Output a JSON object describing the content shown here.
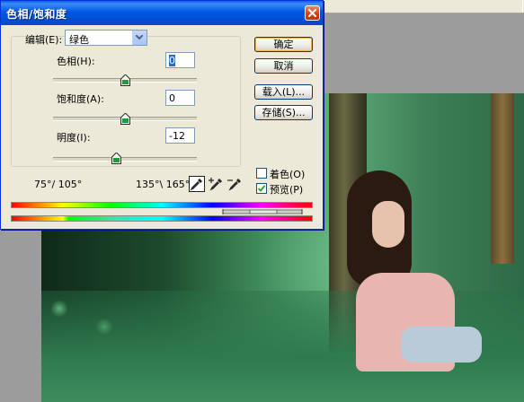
{
  "dialog": {
    "title": "色相/饱和度",
    "edit_label": "编辑(E):",
    "edit_value": "绿色",
    "hue_label": "色相(H):",
    "hue_value": "0",
    "saturation_label": "饱和度(A):",
    "saturation_value": "0",
    "lightness_label": "明度(I):",
    "lightness_value": "-12",
    "range_left": "75°/ 105°",
    "range_right": "135°\\ 165°",
    "buttons": {
      "ok": "确定",
      "cancel": "取消",
      "load": "载入(L)...",
      "save": "存储(S)..."
    },
    "colorize_label": "着色(O)",
    "preview_label": "预览(P)",
    "colorize_checked": false,
    "preview_checked": true
  },
  "sliders": {
    "hue_level": 0.5,
    "saturation_level": 0.5,
    "lightness_level": 0.44
  },
  "icons": [
    "close-icon",
    "dropdown-arrow-icon",
    "eyedropper-icon",
    "eyedropper-plus-icon",
    "eyedropper-minus-icon",
    "checkmark-icon"
  ],
  "colors": {
    "title_bar": "#0058e3",
    "dialog_bg": "#ece9d8",
    "close_button": "#d3441e"
  }
}
